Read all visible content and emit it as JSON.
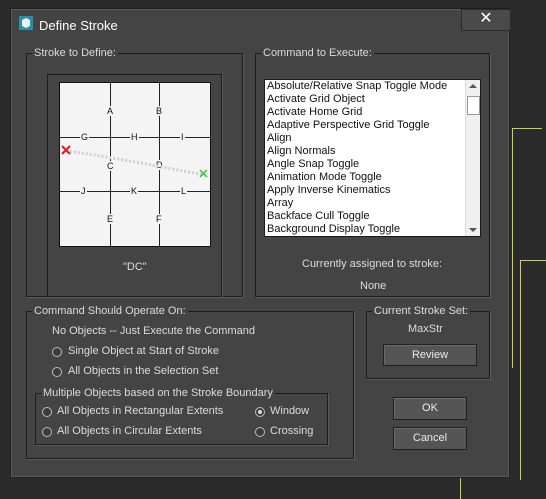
{
  "window": {
    "title": "Define Stroke",
    "close_symbol": "✕"
  },
  "stroke_panel": {
    "legend": "Stroke to Define:",
    "grid_labels": {
      "A": "A",
      "B": "B",
      "G": "G",
      "H": "H",
      "I": "I",
      "C": "C",
      "D": "D",
      "J": "J",
      "K": "K",
      "L": "L",
      "E": "E",
      "F": "F"
    },
    "stroke_name": "\"DC\"",
    "start_marker_color": "#e8192c",
    "end_marker_color": "#2ecc40"
  },
  "command_panel": {
    "legend": "Command to Execute:",
    "commands": [
      "Absolute/Relative Snap Toggle Mode",
      "Activate Grid Object",
      "Activate Home Grid",
      "Adaptive Perspective Grid Toggle",
      "Align",
      "Align Normals",
      "Angle Snap Toggle",
      "Animation Mode Toggle",
      "Apply Inverse Kinematics",
      "Array",
      "Backface Cull Toggle",
      "Background Display Toggle"
    ],
    "assigned_label": "Currently assigned to stroke:",
    "assigned_value": "None"
  },
  "operate_panel": {
    "legend": "Command Should Operate On:",
    "no_objects_label": "No Objects -- Just Execute the Command",
    "single_object_label": "Single Object at Start of Stroke",
    "all_selection_label": "All Objects in the Selection Set",
    "multiple": {
      "legend": "Multiple Objects based on the Stroke Boundary",
      "rect_label": "All Objects in Rectangular Extents",
      "circ_label": "All Objects in Circular Extents",
      "window_label": "Window",
      "crossing_label": "Crossing",
      "window_selected": true
    }
  },
  "stroke_set": {
    "legend": "Current Stroke Set:",
    "name": "MaxStr",
    "review_label": "Review"
  },
  "buttons": {
    "ok_label": "OK",
    "cancel_label": "Cancel"
  },
  "colors": {
    "dialog_bg": "#444444",
    "accent_yellow": "#c8d44a"
  }
}
